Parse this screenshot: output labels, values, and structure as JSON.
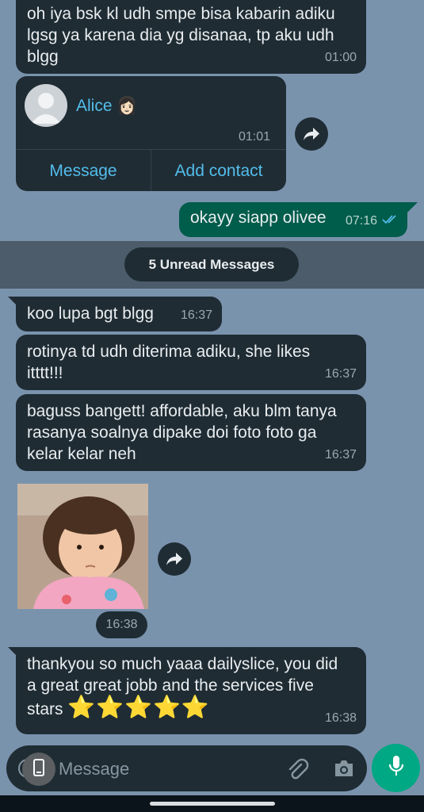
{
  "messages": {
    "m1": {
      "text": "oh iya bsk kl udh smpe bisa kabarin adiku lgsg ya karena dia yg disanaa, tp aku udh blgg",
      "time": "01:00"
    },
    "contact": {
      "name": "Alice 👩🏻",
      "time": "01:01",
      "message_label": "Message",
      "add_contact_label": "Add contact"
    },
    "m2": {
      "text": "okayy siapp olivee",
      "time": "07:16"
    },
    "unread": "5 Unread Messages",
    "m3": {
      "text": "koo lupa bgt blgg",
      "time": "16:37"
    },
    "m4": {
      "text": "rotinya td udh diterima adiku, she likes itttt!!!",
      "time": "16:37"
    },
    "m5": {
      "text": "baguss bangett! affordable, aku blm tanya rasanya soalnya dipake doi foto foto ga kelar kelar neh",
      "time": "16:37"
    },
    "photo": {
      "time": "16:38"
    },
    "m6": {
      "text": "thankyou so much yaaa dailyslice, you did a great great jobb and the services five stars",
      "stars": "⭐⭐⭐⭐⭐",
      "time": "16:38"
    }
  },
  "input": {
    "placeholder": "Message"
  },
  "colors": {
    "background": "#7a93ad",
    "bubble_in": "#1f2c34",
    "bubble_out": "#005c4b",
    "accent": "#00a884",
    "link": "#53bdeb"
  }
}
